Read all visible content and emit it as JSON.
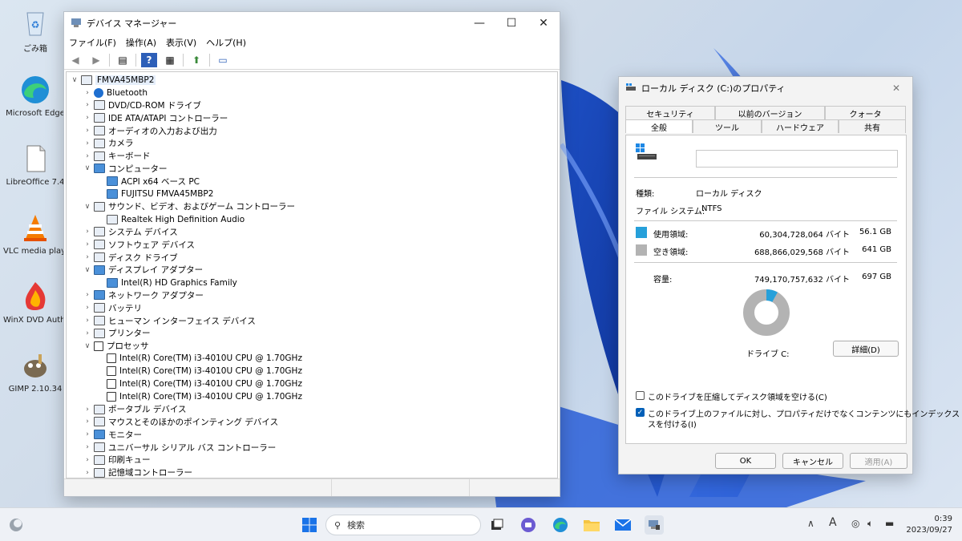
{
  "desktop_icons": [
    {
      "label": "ごみ箱",
      "icon": "recycle-bin-icon"
    },
    {
      "label": "Microsoft Edge",
      "icon": "edge-icon"
    },
    {
      "label": "LibreOffice 7.4",
      "icon": "libreoffice-icon"
    },
    {
      "label": "VLC media player",
      "icon": "vlc-icon"
    },
    {
      "label": "WinX DVD Author",
      "icon": "winx-dvd-icon"
    },
    {
      "label": "GIMP 2.10.34",
      "icon": "gimp-icon"
    }
  ],
  "devmgr": {
    "title": "デバイス マネージャー",
    "menu": [
      "ファイル(F)",
      "操作(A)",
      "表示(V)",
      "ヘルプ(H)"
    ],
    "tree": [
      {
        "label": "FMVA45MBP2",
        "level": 0,
        "state": "expanded",
        "icon": "computer"
      },
      {
        "label": "Bluetooth",
        "level": 1,
        "state": "collapsed",
        "icon": "bt"
      },
      {
        "label": "DVD/CD-ROM ドライブ",
        "level": 1,
        "state": "collapsed",
        "icon": "dev"
      },
      {
        "label": "IDE ATA/ATAPI コントローラー",
        "level": 1,
        "state": "collapsed",
        "icon": "dev"
      },
      {
        "label": "オーディオの入力および出力",
        "level": 1,
        "state": "collapsed",
        "icon": "dev"
      },
      {
        "label": "カメラ",
        "level": 1,
        "state": "collapsed",
        "icon": "dev"
      },
      {
        "label": "キーボード",
        "level": 1,
        "state": "collapsed",
        "icon": "dev"
      },
      {
        "label": "コンピューター",
        "level": 1,
        "state": "expanded",
        "icon": "mon"
      },
      {
        "label": "ACPI x64 ベース PC",
        "level": 2,
        "state": "none",
        "icon": "mon"
      },
      {
        "label": "FUJITSU FMVA45MBP2",
        "level": 2,
        "state": "none",
        "icon": "mon"
      },
      {
        "label": "サウンド、ビデオ、およびゲーム コントローラー",
        "level": 1,
        "state": "expanded",
        "icon": "dev"
      },
      {
        "label": "Realtek High Definition Audio",
        "level": 2,
        "state": "none",
        "icon": "dev"
      },
      {
        "label": "システム デバイス",
        "level": 1,
        "state": "collapsed",
        "icon": "dev"
      },
      {
        "label": "ソフトウェア デバイス",
        "level": 1,
        "state": "collapsed",
        "icon": "dev"
      },
      {
        "label": "ディスク ドライブ",
        "level": 1,
        "state": "collapsed",
        "icon": "dev"
      },
      {
        "label": "ディスプレイ アダプター",
        "level": 1,
        "state": "expanded",
        "icon": "mon"
      },
      {
        "label": "Intel(R) HD Graphics Family",
        "level": 2,
        "state": "none",
        "icon": "mon"
      },
      {
        "label": "ネットワーク アダプター",
        "level": 1,
        "state": "collapsed",
        "icon": "mon"
      },
      {
        "label": "バッテリ",
        "level": 1,
        "state": "collapsed",
        "icon": "dev"
      },
      {
        "label": "ヒューマン インターフェイス デバイス",
        "level": 1,
        "state": "collapsed",
        "icon": "dev"
      },
      {
        "label": "プリンター",
        "level": 1,
        "state": "collapsed",
        "icon": "dev"
      },
      {
        "label": "プロセッサ",
        "level": 1,
        "state": "expanded",
        "icon": "chip"
      },
      {
        "label": "Intel(R) Core(TM) i3-4010U CPU @ 1.70GHz",
        "level": 2,
        "state": "none",
        "icon": "chip"
      },
      {
        "label": "Intel(R) Core(TM) i3-4010U CPU @ 1.70GHz",
        "level": 2,
        "state": "none",
        "icon": "chip"
      },
      {
        "label": "Intel(R) Core(TM) i3-4010U CPU @ 1.70GHz",
        "level": 2,
        "state": "none",
        "icon": "chip"
      },
      {
        "label": "Intel(R) Core(TM) i3-4010U CPU @ 1.70GHz",
        "level": 2,
        "state": "none",
        "icon": "chip"
      },
      {
        "label": "ポータブル デバイス",
        "level": 1,
        "state": "collapsed",
        "icon": "dev"
      },
      {
        "label": "マウスとそのほかのポインティング デバイス",
        "level": 1,
        "state": "collapsed",
        "icon": "dev"
      },
      {
        "label": "モニター",
        "level": 1,
        "state": "collapsed",
        "icon": "mon"
      },
      {
        "label": "ユニバーサル シリアル バス コントローラー",
        "level": 1,
        "state": "collapsed",
        "icon": "dev"
      },
      {
        "label": "印刷キュー",
        "level": 1,
        "state": "collapsed",
        "icon": "dev"
      },
      {
        "label": "記憶域コントローラー",
        "level": 1,
        "state": "collapsed",
        "icon": "dev"
      }
    ]
  },
  "props": {
    "title": "ローカル ディスク (C:)のプロパティ",
    "tabs_top": [
      "セキュリティ",
      "以前のバージョン",
      "クォータ"
    ],
    "tabs_bottom": [
      "全般",
      "ツール",
      "ハードウェア",
      "共有"
    ],
    "name_value": "",
    "type_label": "種類:",
    "type_value": "ローカル ディスク",
    "fs_label": "ファイル システム:",
    "fs_value": "NTFS",
    "used_label": "使用領域:",
    "used_bytes": "60,304,728,064 バイト",
    "used_gb": "56.1 GB",
    "free_label": "空き領域:",
    "free_bytes": "688,866,029,568 バイト",
    "free_gb": "641 GB",
    "cap_label": "容量:",
    "cap_bytes": "749,170,757,632 バイト",
    "cap_gb": "697 GB",
    "used_fraction": 0.08,
    "drive_label": "ドライブ C:",
    "details_button": "詳細(D)",
    "compress_label": "このドライブを圧縮してディスク領域を空ける(C)",
    "index_label_1": "このドライブ上のファイルに対し、プロパティだけでなくコンテンツにもインデックス",
    "index_label_2": "スを付ける(I)",
    "ok": "OK",
    "cancel": "キャンセル",
    "apply": "適用(A)",
    "colors": {
      "used": "#26a0da",
      "free": "#b3b3b3"
    }
  },
  "taskbar": {
    "search_placeholder": "検索",
    "time": "0:39",
    "date": "2023/09/27",
    "ime": "A"
  }
}
